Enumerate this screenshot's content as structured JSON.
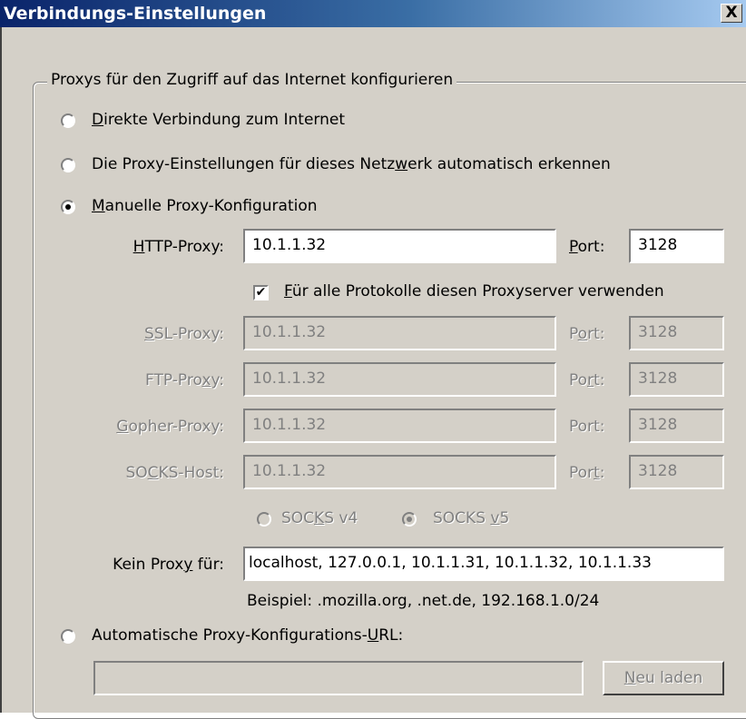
{
  "window": {
    "title": "Verbindungs-Einstellungen",
    "close_glyph": "X"
  },
  "group": {
    "legend": "Proxys für den Zugriff auf das Internet konfigurieren"
  },
  "options": {
    "direct": {
      "pre": "",
      "key": "D",
      "post": "irekte Verbindung zum Internet",
      "selected": false
    },
    "auto_detect": {
      "pre": "Die Proxy-Einstellungen für dieses Netz",
      "key": "w",
      "post": "erk automatisch erkennen",
      "selected": false
    },
    "manual": {
      "pre": "",
      "key": "M",
      "post": "anuelle Proxy-Konfiguration",
      "selected": true
    },
    "auto_url": {
      "pre": "Automatische Proxy-Konfigurations-",
      "key": "U",
      "post": "RL:",
      "selected": false
    }
  },
  "proxies": [
    {
      "id": "http",
      "label_pre": "",
      "label_key": "H",
      "label_post": "TTP-Proxy:",
      "value": "10.1.1.32",
      "port_pre": "",
      "port_key": "P",
      "port_post": "ort:",
      "port": "3128",
      "enabled": true
    },
    {
      "id": "ssl",
      "label_pre": "",
      "label_key": "S",
      "label_post": "SL-Proxy:",
      "value": "10.1.1.32",
      "port_pre": "P",
      "port_key": "o",
      "port_post": "rt:",
      "port": "3128",
      "enabled": false
    },
    {
      "id": "ftp",
      "label_pre": "FTP-Pro",
      "label_key": "x",
      "label_post": "y:",
      "value": "10.1.1.32",
      "port_pre": "Po",
      "port_key": "r",
      "port_post": "t:",
      "port": "3128",
      "enabled": false
    },
    {
      "id": "gopher",
      "label_pre": "",
      "label_key": "G",
      "label_post": "opher-Proxy:",
      "value": "10.1.1.32",
      "port_pre": "Port:",
      "port_key": "",
      "port_post": "",
      "port": "3128",
      "enabled": false
    },
    {
      "id": "socks",
      "label_pre": "SO",
      "label_key": "C",
      "label_post": "KS-Host:",
      "value": "10.1.1.32",
      "port_pre": "Por",
      "port_key": "t",
      "port_post": ":",
      "port": "3128",
      "enabled": false
    }
  ],
  "use_same": {
    "pre": "",
    "key": "F",
    "post": "ür alle Protokolle diesen Proxyserver verwenden",
    "checked": true,
    "check_glyph": "✔"
  },
  "socks_versions": {
    "v4": {
      "pre": "SOC",
      "key": "K",
      "post": "S v4",
      "selected": false
    },
    "v5": {
      "pre": "SOCKS ",
      "key": "v",
      "post": "5",
      "selected": true
    }
  },
  "no_proxy": {
    "label_pre": "Kein Prox",
    "label_key": "y",
    "label_post": " für:",
    "value": "localhost, 127.0.0.1, 10.1.1.31, 10.1.1.32, 10.1.1.33",
    "example": "Beispiel: .mozilla.org, .net.de, 192.168.1.0/24"
  },
  "auto_config": {
    "url_value": "",
    "reload_pre": "",
    "reload_key": "N",
    "reload_post": "eu laden"
  }
}
